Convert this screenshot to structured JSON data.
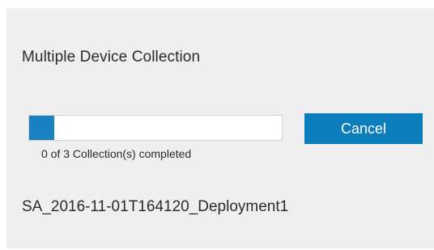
{
  "dialog": {
    "title": "Multiple Device Collection",
    "progress": {
      "completed": 0,
      "total": 3,
      "fill_fraction": 0.1,
      "status_text": "0 of 3 Collection(s) completed",
      "fill_color": "#1a82c3"
    },
    "cancel_label": "Cancel",
    "cancel_color": "#0b7dbd",
    "deployment_name": "SA_2016-11-01T164120_Deployment1"
  }
}
